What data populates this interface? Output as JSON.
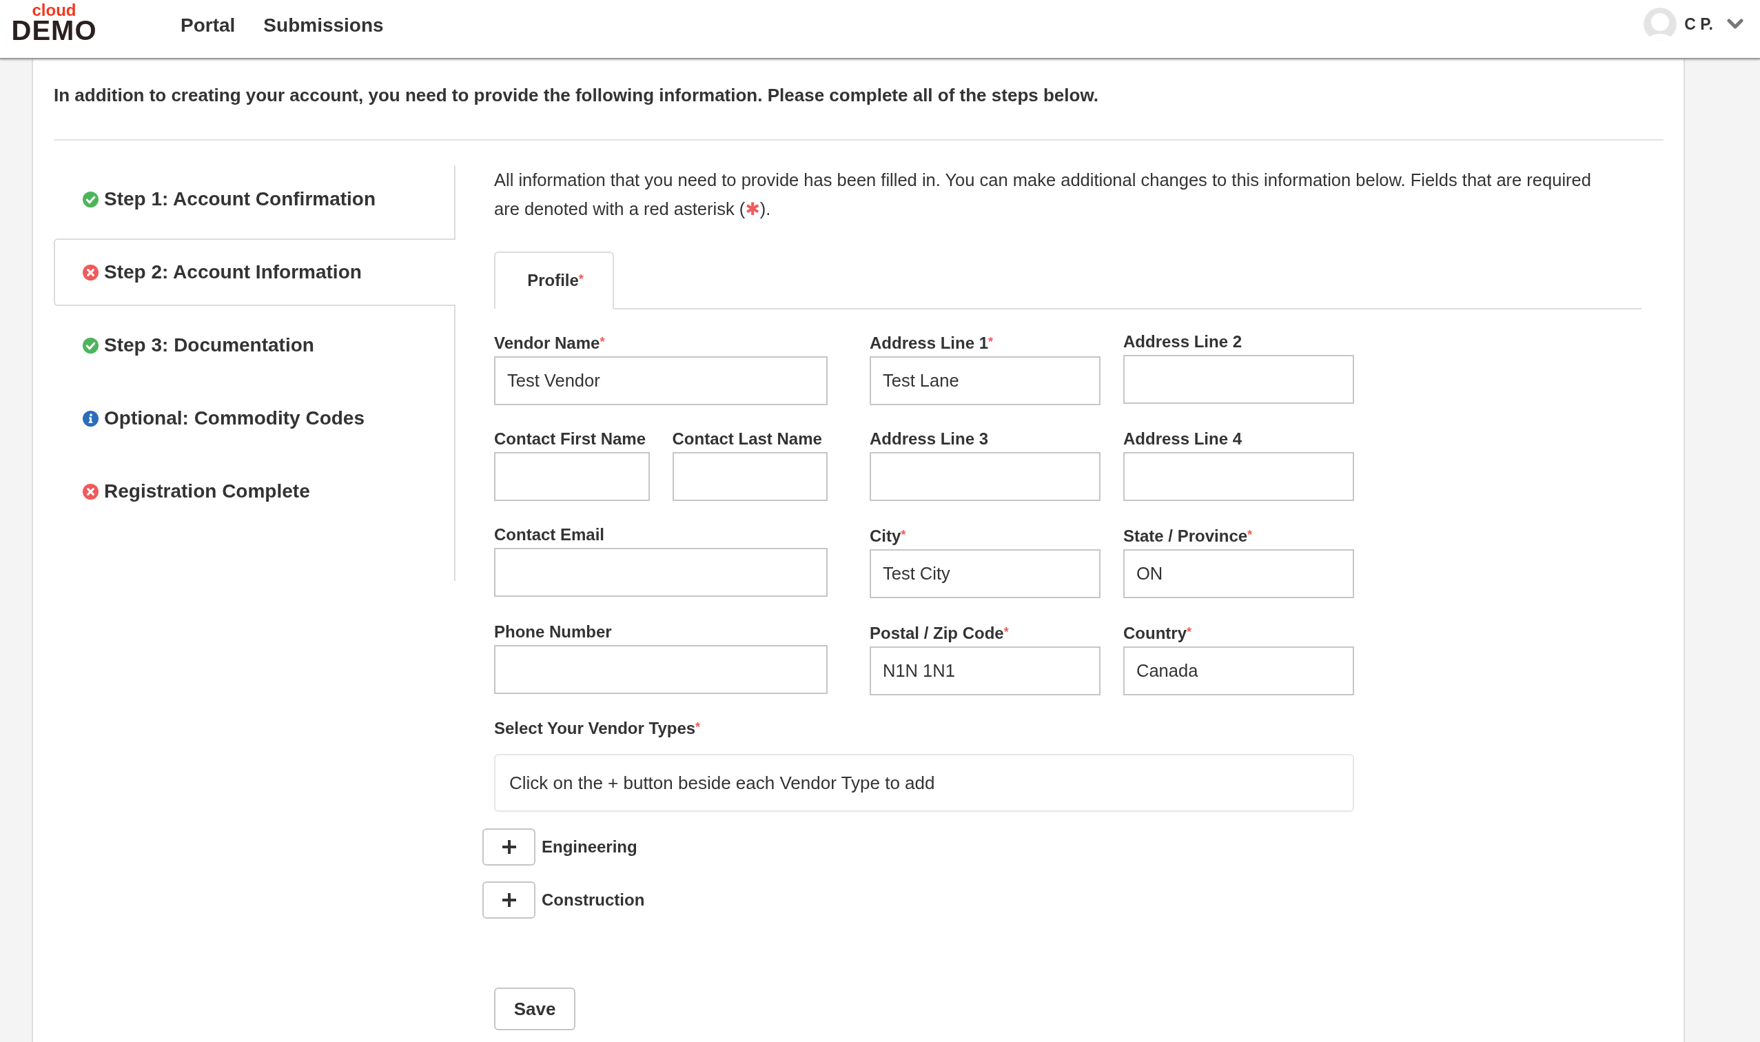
{
  "header": {
    "logo": {
      "small_text": "cloud",
      "wordmark": "DEMO"
    },
    "nav": [
      {
        "label": "Portal"
      },
      {
        "label": "Submissions"
      }
    ],
    "user": {
      "name": "C P."
    }
  },
  "intro": "In addition to creating your account, you need to provide the following information. Please complete all of the steps below.",
  "steps": [
    {
      "label": "Step 1: Account Confirmation",
      "kind": "complete",
      "selected": false
    },
    {
      "label": "Step 2: Account Information",
      "kind": "incomplete",
      "selected": true
    },
    {
      "label": "Step 3: Documentation",
      "kind": "complete",
      "selected": false
    },
    {
      "label": "Optional: Commodity Codes",
      "kind": "optional",
      "selected": false
    },
    {
      "label": "Registration Complete",
      "kind": "incomplete",
      "selected": false
    }
  ],
  "notice": {
    "before": "All information that you need to provide has been filled in. You can make additional changes to this information below. Fields that are required are denoted with a red asterisk (",
    "mark": "✱",
    "after": ")."
  },
  "tabs": [
    {
      "label": "Profile",
      "required_mark": "*",
      "selected": true
    }
  ],
  "form": {
    "rows": [
      {
        "columns": [
          {
            "fields": [
              {
                "label": "Vendor Name",
                "required_mark": "*",
                "value": "Test Vendor"
              }
            ]
          },
          {
            "fields": [
              {
                "label": "Address Line 1",
                "required_mark": "*",
                "value": "Test Lane"
              }
            ]
          },
          {
            "fields": [
              {
                "label": "Address Line 2"
              }
            ]
          }
        ]
      },
      {
        "columns": [
          {
            "fields": [
              {
                "label": "Contact First Name"
              },
              {
                "label": "Contact Last Name"
              }
            ]
          },
          {
            "fields": [
              {
                "label": "Address Line 3"
              }
            ]
          },
          {
            "fields": [
              {
                "label": "Address Line 4"
              }
            ]
          }
        ]
      },
      {
        "columns": [
          {
            "fields": [
              {
                "label": "Contact Email"
              }
            ]
          },
          {
            "fields": [
              {
                "label": "City",
                "required_mark": "*",
                "value": "Test City"
              }
            ]
          },
          {
            "fields": [
              {
                "label": "State / Province",
                "required_mark": "*",
                "value": "ON"
              }
            ]
          }
        ]
      },
      {
        "columns": [
          {
            "fields": [
              {
                "label": "Phone Number"
              }
            ]
          },
          {
            "fields": [
              {
                "label": "Postal / Zip Code",
                "required_mark": "*",
                "value": "N1N 1N1"
              }
            ]
          },
          {
            "fields": [
              {
                "label": "Country",
                "required_mark": "*",
                "value": "Canada"
              }
            ]
          }
        ]
      }
    ]
  },
  "vendor_types": {
    "label": "Select Your Vendor Types",
    "required_mark": "*",
    "empty_message": "Click on the + button beside each Vendor Type to add",
    "options": [
      {
        "label": "Engineering"
      },
      {
        "label": "Construction"
      }
    ]
  },
  "save_button": {
    "label": "Save"
  }
}
